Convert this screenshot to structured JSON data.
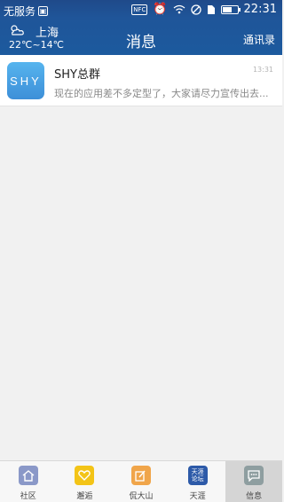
{
  "status_bar": {
    "carrier": "无服务",
    "nfc": "NFC",
    "time": "22:31",
    "battery_level": 0.6
  },
  "header": {
    "city": "上海",
    "temperature": "22℃~14℃",
    "title": "消息",
    "contacts_label": "通讯录"
  },
  "messages": [
    {
      "avatar_text": "SHY",
      "name": "SHY总群",
      "time": "13:31",
      "preview": "现在的应用差不多定型了，大家请尽力宣传出去..."
    }
  ],
  "tabs": [
    {
      "label": "社区",
      "icon": "home-icon"
    },
    {
      "label": "邂逅",
      "icon": "heart-icon"
    },
    {
      "label": "侃大山",
      "icon": "edit-icon"
    },
    {
      "label": "天涯",
      "icon": "tianya-forum-icon",
      "icon_text_1": "天涯",
      "icon_text_2": "论坛"
    },
    {
      "label": "信息",
      "icon": "chat-icon"
    }
  ],
  "colors": {
    "header": "#1f5599",
    "background": "#f1f1f1",
    "active_tab": "#d5d5d5"
  }
}
